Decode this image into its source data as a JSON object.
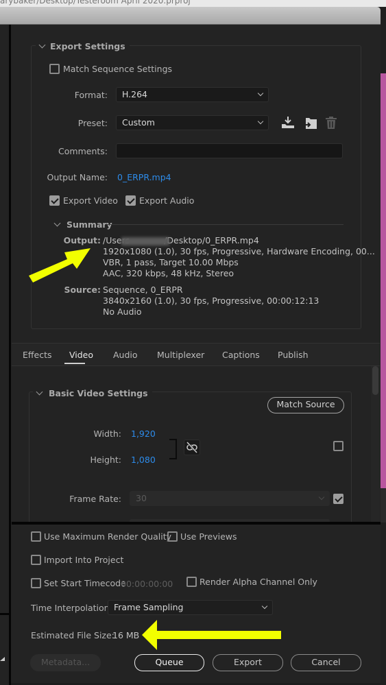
{
  "window": {
    "title_fragment": "arybaker/Desktop/Testeroom April 2020.prproj"
  },
  "export_settings": {
    "group_title": "Export Settings",
    "match_sequence": {
      "label": "Match Sequence Settings",
      "checked": false
    },
    "format": {
      "label": "Format:",
      "value": "H.264"
    },
    "preset": {
      "label": "Preset:",
      "value": "Custom"
    },
    "preset_icons": [
      "save-preset-icon",
      "import-preset-icon",
      "delete-preset-icon"
    ],
    "comments": {
      "label": "Comments:",
      "value": ""
    },
    "output_name": {
      "label": "Output Name:",
      "value": "0_ERPR.mp4"
    },
    "export_video": {
      "label": "Export Video",
      "checked": true
    },
    "export_audio": {
      "label": "Export Audio",
      "checked": true
    },
    "summary": {
      "title": "Summary",
      "output_label": "Output:",
      "output_lines": [
        "/Users    /Desktop/0_ERPR.mp4",
        "1920x1080 (1.0), 30 fps, Progressive, Hardware Encoding, 00...",
        "VBR, 1 pass, Target 10.00 Mbps",
        "AAC, 320 kbps, 48 kHz, Stereo"
      ],
      "source_label": "Source:",
      "source_lines": [
        "Sequence, 0_ERPR",
        "3840x2160 (1.0), 30 fps, Progressive, 00:00:12:13",
        "No Audio"
      ]
    }
  },
  "tabs": [
    {
      "label": "Effects",
      "active": false
    },
    {
      "label": "Video",
      "active": true
    },
    {
      "label": "Audio",
      "active": false
    },
    {
      "label": "Multiplexer",
      "active": false
    },
    {
      "label": "Captions",
      "active": false
    },
    {
      "label": "Publish",
      "active": false
    }
  ],
  "video_settings": {
    "group_title": "Basic Video Settings",
    "match_source_label": "Match Source",
    "width": {
      "label": "Width:",
      "value": "1,920"
    },
    "height": {
      "label": "Height:",
      "value": "1,080"
    },
    "dimension_override_checked": false,
    "frame_rate": {
      "label": "Frame Rate:",
      "value": "30",
      "override_checked": true
    }
  },
  "bottom": {
    "max_render_quality": {
      "label": "Use Maximum Render Quality",
      "checked": false
    },
    "use_previews": {
      "label": "Use Previews",
      "checked": false
    },
    "import_into_project": {
      "label": "Import Into Project",
      "checked": false
    },
    "set_start_timecode": {
      "label": "Set Start Timecode",
      "checked": false,
      "timecode": "00:00:00:00"
    },
    "render_alpha": {
      "label": "Render Alpha Channel Only",
      "checked": false
    },
    "time_interpolation": {
      "label": "Time Interpolation:",
      "value": "Frame Sampling"
    },
    "file_size": {
      "label": "Estimated File Size:",
      "value": "16 MB"
    },
    "buttons": {
      "metadata": "Metadata...",
      "queue": "Queue",
      "export": "Export",
      "cancel": "Cancel"
    }
  },
  "annotations": {
    "arrow_color": "#f2ff00"
  },
  "colors": {
    "accent_link": "#2d8ceb",
    "background": "#232323",
    "side_panel_pink": "#b8579f"
  }
}
